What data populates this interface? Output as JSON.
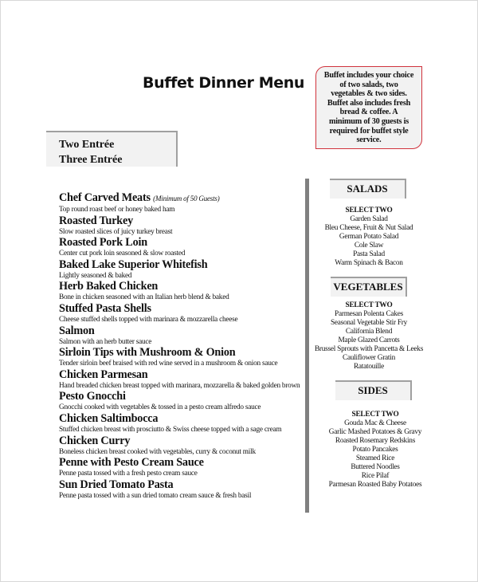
{
  "title": "Buffet Dinner Menu",
  "note": {
    "lines": [
      "Buffet includes your choice",
      "of two salads, two",
      "vegetables & two sides.",
      "Buffet also includes fresh",
      "bread & coffee.  A",
      "minimum of 30 guests is",
      "required for buffet style",
      "service."
    ]
  },
  "entree_options": [
    "Two Entrée",
    "Three Entrée"
  ],
  "entrees": [
    {
      "name": "Chef Carved Meats",
      "note": "(Minimum of 50 Guests)",
      "desc": "Top round roast beef or honey baked ham"
    },
    {
      "name": "Roasted Turkey",
      "desc": "Slow roasted slices of juicy turkey breast"
    },
    {
      "name": "Roasted Pork Loin",
      "desc": "Center cut pork loin seasoned & slow roasted"
    },
    {
      "name": "Baked Lake Superior Whitefish",
      "desc": "Lightly seasoned & baked"
    },
    {
      "name": "Herb Baked Chicken",
      "desc": "Bone in chicken seasoned with an Italian herb blend & baked"
    },
    {
      "name": "Stuffed Pasta Shells",
      "desc": "Cheese stuffed shells topped with marinara & mozzarella cheese"
    },
    {
      "name": "Salmon",
      "desc": "Salmon with an herb butter sauce"
    },
    {
      "name": "Sirloin Tips with Mushroom & Onion",
      "desc": "Tender sirloin beef braised with red wine served in a mushroom & onion sauce"
    },
    {
      "name": "Chicken Parmesan",
      "desc": "Hand breaded chicken breast topped with marinara, mozzarella & baked golden brown"
    },
    {
      "name": "Pesto Gnocchi",
      "desc": "Gnocchi cooked with vegetables & tossed in a pesto cream alfredo sauce"
    },
    {
      "name": "Chicken Saltimbocca",
      "desc": "Stuffed chicken breast with prosciutto & Swiss cheese topped with a sage cream"
    },
    {
      "name": "Chicken Curry",
      "desc": "Boneless chicken breast cooked with vegetables, curry & coconut milk"
    },
    {
      "name": "Penne with Pesto Cream Sauce",
      "desc": "Penne pasta tossed with a fresh pesto cream sauce"
    },
    {
      "name": "Sun Dried Tomato Pasta",
      "desc": "Penne pasta tossed with a sun dried tomato cream sauce & fresh basil"
    }
  ],
  "sections": {
    "salads": {
      "header": "SALADS",
      "select": "SELECT TWO",
      "items": [
        "Garden Salad",
        "Bleu Cheese, Fruit & Nut Salad",
        "German Potato Salad",
        "Cole Slaw",
        "Pasta Salad",
        "Warm Spinach & Bacon"
      ]
    },
    "vegetables": {
      "header": "VEGETABLES",
      "select": "SELECT TWO",
      "items": [
        "Parmesan Polenta Cakes",
        "Seasonal Vegetable Stir Fry",
        "California Blend",
        "Maple Glazed Carrots",
        "Brussel Sprouts with Pancetta & Leeks",
        "Cauliflower Gratin",
        "Ratatouille"
      ]
    },
    "sides": {
      "header": "SIDES",
      "select": "SELECT TWO",
      "items": [
        "Gouda Mac & Cheese",
        "Garlic Mashed Potatoes & Gravy",
        "Roasted Rosemary Redskins",
        "Potato Pancakes",
        "Steamed Rice",
        "Buttered Noodles",
        "Rice Pilaf",
        "Parmesan Roasted Baby Potatoes"
      ]
    }
  },
  "colors": {
    "note_border": "#d0323c",
    "box_fill": "#f2f2f2",
    "divider": "#808080"
  }
}
